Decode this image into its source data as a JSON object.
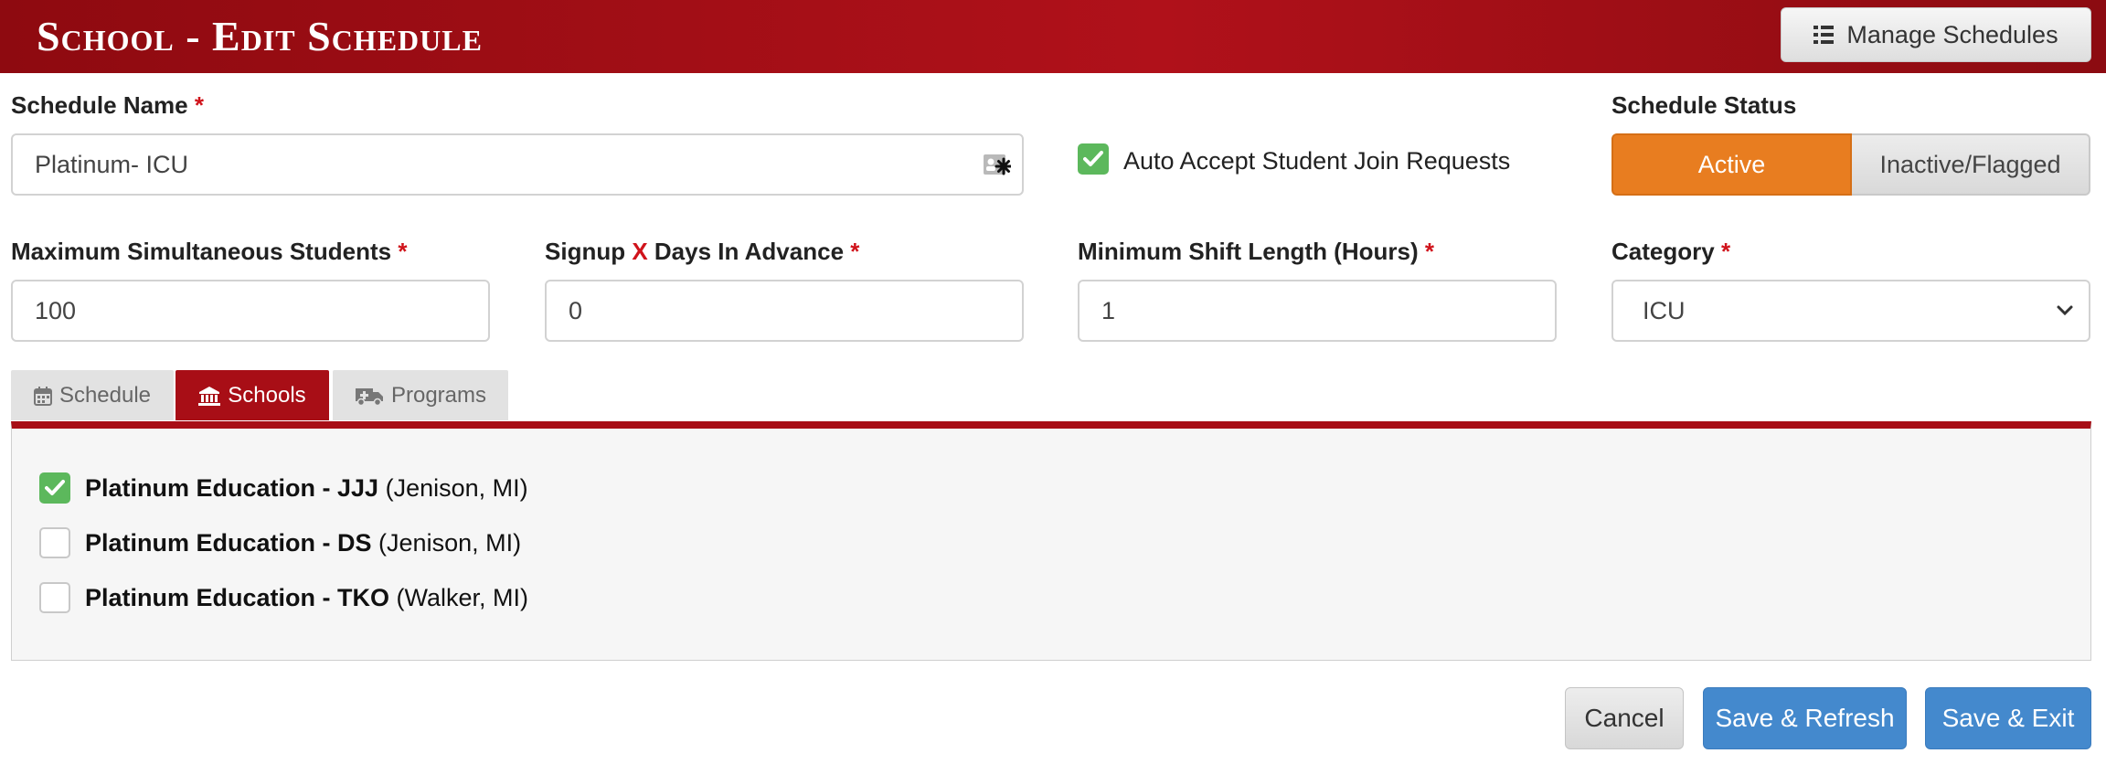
{
  "header": {
    "title": "School - Edit Schedule",
    "manage_button": "Manage Schedules",
    "manage_icon": "list-icon"
  },
  "schedule_name": {
    "label": "Schedule Name",
    "required": "*",
    "value": "Platinum- ICU",
    "icon": "contact-card-icon"
  },
  "auto_accept": {
    "label": "Auto Accept Student Join Requests",
    "checked": true
  },
  "schedule_status": {
    "label": "Schedule Status",
    "active": "Active",
    "inactive": "Inactive/Flagged",
    "selected": "Active"
  },
  "max_students": {
    "label": "Maximum Simultaneous Students",
    "required": "*",
    "value": "100"
  },
  "signup_days": {
    "label_pre": "Signup",
    "label_x": "X",
    "label_post": "Days In Advance",
    "required": "*",
    "value": "0"
  },
  "min_shift": {
    "label": "Minimum Shift Length (Hours)",
    "required": "*",
    "value": "1"
  },
  "category": {
    "label": "Category",
    "required": "*",
    "value": "ICU"
  },
  "tabs": [
    {
      "label": "Schedule",
      "icon": "calendar-icon",
      "active": false
    },
    {
      "label": "Schools",
      "icon": "institution-icon",
      "active": true
    },
    {
      "label": "Programs",
      "icon": "ambulance-icon",
      "active": false
    }
  ],
  "schools": [
    {
      "name": "Platinum Education - JJJ",
      "location": "(Jenison, MI)",
      "checked": true
    },
    {
      "name": "Platinum Education - DS",
      "location": "(Jenison, MI)",
      "checked": false
    },
    {
      "name": "Platinum Education - TKO",
      "location": "(Walker, MI)",
      "checked": false
    }
  ],
  "actions": {
    "cancel": "Cancel",
    "save_refresh": "Save & Refresh",
    "save_exit": "Save & Exit"
  },
  "colors": {
    "header_red": "#a80e16",
    "active_orange": "#e87d20",
    "check_green": "#5cb85c",
    "primary_blue": "#4489cd"
  }
}
